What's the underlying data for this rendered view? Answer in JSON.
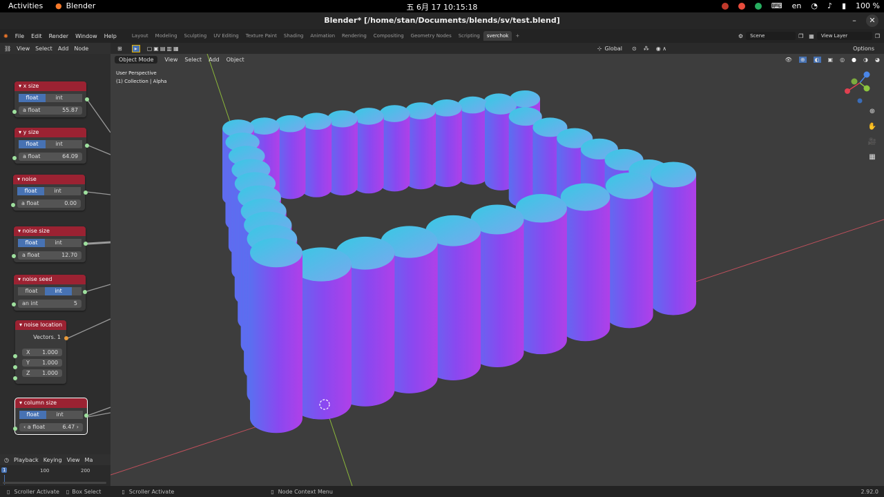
{
  "topbar": {
    "activities": "Activities",
    "app_name": "Blender",
    "clock": "五 6月 17  10:15:18",
    "lang": "en",
    "battery": "100 %"
  },
  "window": {
    "title": "Blender* [/home/stan/Documents/blends/sv/test.blend]"
  },
  "menubar": {
    "menus": [
      "File",
      "Edit",
      "Render",
      "Window",
      "Help"
    ],
    "workspaces": [
      "Layout",
      "Modeling",
      "Sculpting",
      "UV Editing",
      "Texture Paint",
      "Shading",
      "Animation",
      "Rendering",
      "Compositing",
      "Geometry Nodes",
      "Scripting",
      "sverchok"
    ],
    "active_workspace": "sverchok",
    "scene": "Scene",
    "view_layer": "View Layer"
  },
  "node_editor": {
    "menus": [
      "View",
      "Select",
      "Add",
      "Node"
    ],
    "nodes": [
      {
        "title": "x size",
        "mode": "float",
        "label": "a float",
        "value": "55.87",
        "selected": false
      },
      {
        "title": "y size",
        "mode": "float",
        "label": "a float",
        "value": "64.09",
        "selected": false
      },
      {
        "title": "noise",
        "mode": "float",
        "label": "a float",
        "value": "0.00",
        "selected": false
      },
      {
        "title": "noise size",
        "mode": "float",
        "label": "a float",
        "value": "12.70",
        "selected": false
      },
      {
        "title": "noise seed",
        "mode": "int",
        "label": "an int",
        "value": "5",
        "selected": false
      },
      {
        "title": "column size",
        "mode": "float",
        "label": "a float",
        "value": "6.47",
        "selected": true
      }
    ],
    "toggle_labels": [
      "float",
      "int"
    ],
    "vector_node": {
      "title": "noise  location",
      "output": "Vectors. 1",
      "fields": [
        {
          "axis": "X",
          "value": "1.000"
        },
        {
          "axis": "Y",
          "value": "1.000"
        },
        {
          "axis": "Z",
          "value": "1.000"
        }
      ]
    }
  },
  "timeline": {
    "menus": [
      "Playback",
      "Keying",
      "View",
      "Ma"
    ],
    "current_frame": "1",
    "ticks": [
      "100",
      "200"
    ]
  },
  "viewport": {
    "mode": "Object Mode",
    "menus": [
      "View",
      "Select",
      "Add",
      "Object"
    ],
    "orientation": "Global",
    "options": "Options",
    "perspective": "User Perspective",
    "collection": "(1) Collection | Alpha",
    "background_color": "#3d3d3d"
  },
  "statusbar": {
    "items": [
      "Scroller Activate",
      "Box Select",
      "Scroller Activate",
      "Node Context Menu"
    ],
    "version": "2.92.0"
  },
  "colors": {
    "node_header": "#9b2232",
    "toggle_active": "#4772b3",
    "socket_float": "#9ee09e",
    "socket_vector": "#e89a3a",
    "cylinder_top": "#45c4e6",
    "cylinder_side": "#9b3cf0"
  }
}
